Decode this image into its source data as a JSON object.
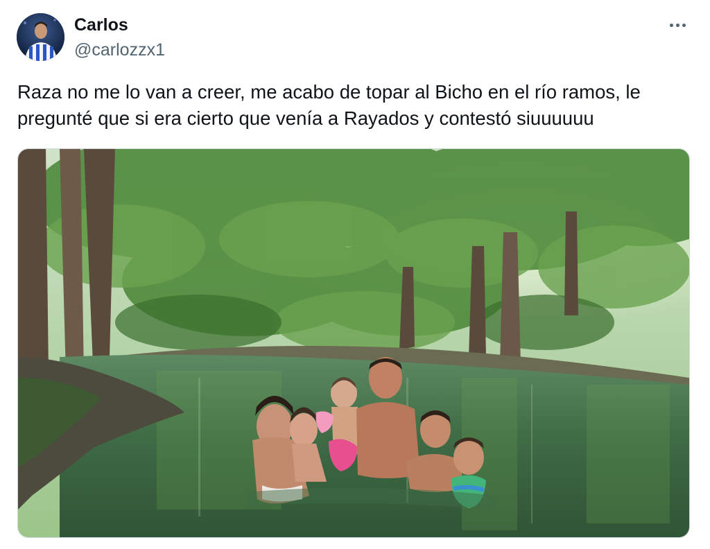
{
  "author": {
    "display_name": "Carlos",
    "handle": "@carlozzx1",
    "avatar_icon": "profile-avatar"
  },
  "menu": {
    "icon": "more-horizontal-icon"
  },
  "tweet": {
    "text": "Raza no me lo van a creer, me acabo de topar al Bicho en el río ramos, le\npregunté que si era cierto que venía a Rayados y contestó siuuuuuu"
  },
  "media": {
    "type": "photo",
    "palette": {
      "foliage": "#4f8a3c",
      "water": "#3f6b45",
      "bark": "#5a4a3c",
      "sky": "#dfeedd"
    }
  },
  "colors": {
    "text_primary": "#0f1419",
    "text_secondary": "#536471",
    "border": "#cfd9de"
  }
}
